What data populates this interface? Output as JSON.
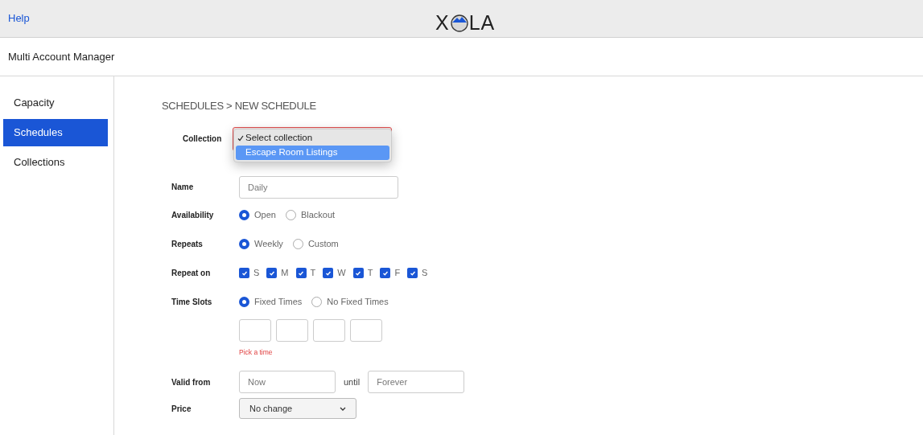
{
  "header": {
    "help_link": "Help",
    "logo": {
      "before": "X",
      "after": "LA"
    }
  },
  "page_title": "Multi Account Manager",
  "sidebar": {
    "items": [
      {
        "label": "Capacity",
        "selected": false
      },
      {
        "label": "Schedules",
        "selected": true
      },
      {
        "label": "Collections",
        "selected": false
      }
    ]
  },
  "breadcrumb": "SCHEDULES > NEW SCHEDULE",
  "form": {
    "collection": {
      "label": "Collection",
      "invalid": true,
      "menu": [
        {
          "label": "Select collection",
          "checked": true,
          "selected": false
        },
        {
          "label": "Escape Room Listings",
          "checked": false,
          "selected": true
        }
      ]
    },
    "name": {
      "label": "Name",
      "placeholder": "Daily"
    },
    "availability": {
      "label": "Availability",
      "options": [
        {
          "label": "Open",
          "selected": true
        },
        {
          "label": "Blackout",
          "selected": false
        }
      ]
    },
    "repeats": {
      "label": "Repeats",
      "options": [
        {
          "label": "Weekly",
          "selected": true
        },
        {
          "label": "Custom",
          "selected": false
        }
      ]
    },
    "repeat_on": {
      "label": "Repeat on",
      "days": [
        {
          "label": "S",
          "checked": true
        },
        {
          "label": "M",
          "checked": true
        },
        {
          "label": "T",
          "checked": true
        },
        {
          "label": "W",
          "checked": true
        },
        {
          "label": "T",
          "checked": true
        },
        {
          "label": "F",
          "checked": true
        },
        {
          "label": "S",
          "checked": true
        }
      ]
    },
    "time_slots": {
      "label": "Time Slots",
      "options": [
        {
          "label": "Fixed Times",
          "selected": true
        },
        {
          "label": "No Fixed Times",
          "selected": false
        }
      ],
      "slots": [
        {
          "filled": false
        },
        {
          "filled": false
        },
        {
          "filled": false
        },
        {
          "filled": false
        }
      ],
      "error": "Pick a time"
    },
    "valid_from": {
      "label": "Valid from",
      "from_placeholder": "Now",
      "until_label": "until",
      "until_placeholder": "Forever"
    },
    "price": {
      "label": "Price",
      "value": "No change"
    }
  }
}
